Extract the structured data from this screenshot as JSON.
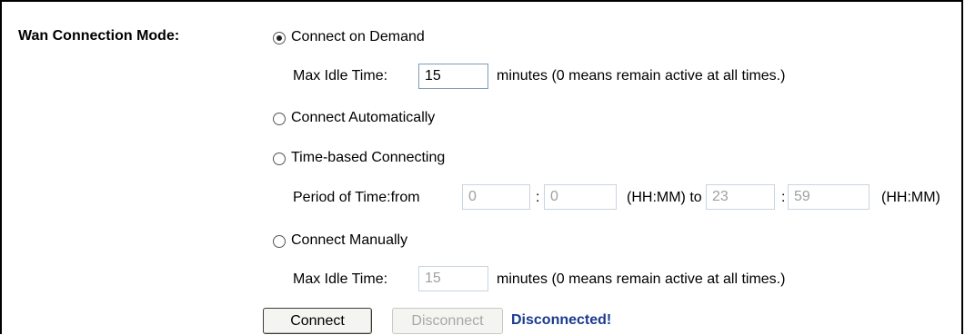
{
  "wan": {
    "label": "Wan Connection Mode:",
    "options": [
      {
        "label": "Connect on Demand",
        "selected": true
      },
      {
        "label": "Connect Automatically",
        "selected": false
      },
      {
        "label": "Time-based Connecting",
        "selected": false
      },
      {
        "label": "Connect Manually",
        "selected": false
      }
    ],
    "demand": {
      "idle_label": "Max Idle Time:",
      "idle_value": "15",
      "idle_note": "minutes (0 means remain active at all times.)"
    },
    "time_based": {
      "period_label": "Period of Time:from",
      "from_hh": "0",
      "colon": ":",
      "from_mm": "0",
      "mid_label": "(HH:MM) to",
      "to_hh": "23",
      "to_mm": "59",
      "end_label": "(HH:MM)"
    },
    "manual": {
      "idle_label": "Max Idle Time:",
      "idle_value": "15",
      "idle_note": "minutes (0 means remain active at all times.)"
    },
    "actions": {
      "connect_label": "Connect",
      "disconnect_label": "Disconnect",
      "status_text": "Disconnected!"
    }
  }
}
